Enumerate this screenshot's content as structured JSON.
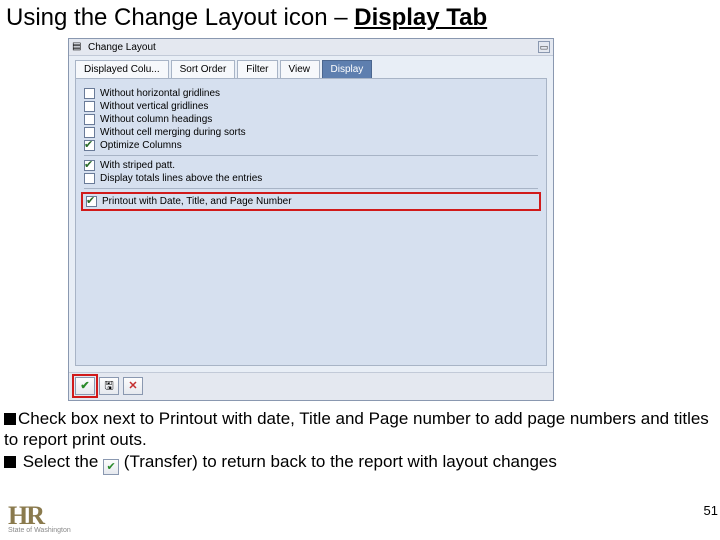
{
  "slide": {
    "title_prefix": "Using the Change Layout icon – ",
    "title_emph": "Display Tab",
    "page_number": "51"
  },
  "dialog": {
    "title": "Change Layout",
    "tabs": [
      {
        "label": "Displayed Colu..."
      },
      {
        "label": "Sort Order"
      },
      {
        "label": "Filter"
      },
      {
        "label": "View"
      },
      {
        "label": "Display"
      }
    ],
    "active_tab_index": 4,
    "options": [
      {
        "label": "Without horizontal gridlines",
        "checked": false
      },
      {
        "label": "Without vertical gridlines",
        "checked": false
      },
      {
        "label": "Without column headings",
        "checked": false
      },
      {
        "label": "Without cell merging during sorts",
        "checked": false
      },
      {
        "label": "Optimize Columns",
        "checked": true
      }
    ],
    "options2": [
      {
        "label": "With striped patt.",
        "checked": true
      },
      {
        "label": "Display totals lines above the entries",
        "checked": false
      }
    ],
    "highlighted_option": {
      "label": "Printout with Date, Title, and Page Number",
      "checked": true
    },
    "buttons": {
      "transfer": "✔",
      "save": "",
      "cancel": "✕"
    }
  },
  "instructions": {
    "line1": "Check box next to Printout with date, Title and Page number to add page numbers and titles to report print outs.",
    "line2a": " Select the ",
    "line2b": "(Transfer) to return back to the report with layout changes"
  },
  "logo": {
    "text": "HR",
    "sub": "State of Washington"
  }
}
